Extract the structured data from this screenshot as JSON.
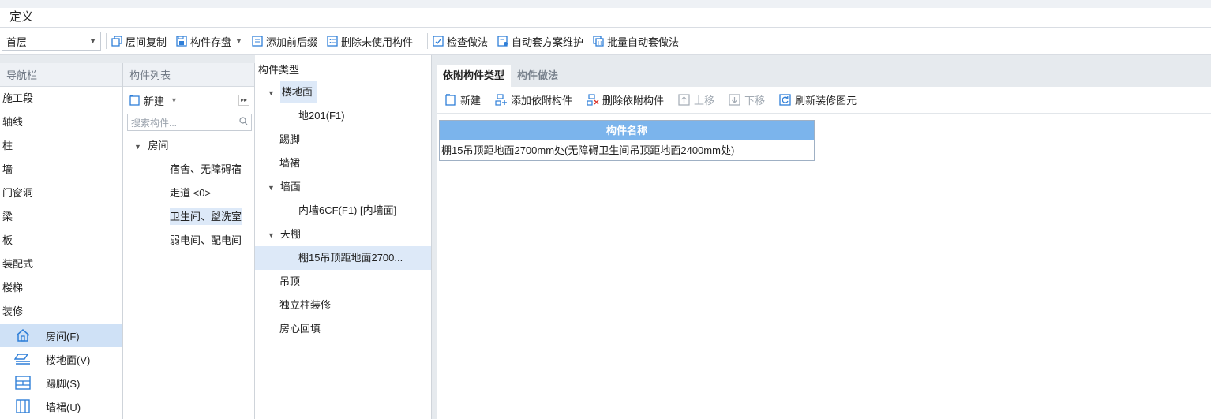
{
  "app": {
    "title": "定义"
  },
  "toolbar": {
    "floor": "首层",
    "buttons": [
      {
        "label": "层间复制",
        "icon": "copy-floors-icon",
        "dropdown": false
      },
      {
        "label": "构件存盘",
        "icon": "save-component-icon",
        "dropdown": true
      },
      {
        "label": "添加前后缀",
        "icon": "add-affix-icon",
        "dropdown": false
      },
      {
        "label": "删除未使用构件",
        "icon": "delete-unused-icon",
        "dropdown": false
      },
      {
        "label": "检查做法",
        "icon": "check-method-icon",
        "dropdown": false
      },
      {
        "label": "自动套方案维护",
        "icon": "auto-scheme-icon",
        "dropdown": false
      },
      {
        "label": "批量自动套做法",
        "icon": "batch-auto-icon",
        "dropdown": false
      }
    ]
  },
  "nav": {
    "header": "导航栏",
    "items": [
      "施工段",
      "轴线",
      "柱",
      "墙",
      "门窗洞",
      "梁",
      "板",
      "装配式",
      "楼梯",
      "装修"
    ],
    "subitems": [
      {
        "label": "房间(F)",
        "icon": "home-icon",
        "active": true
      },
      {
        "label": "楼地面(V)",
        "icon": "floor-surface-icon",
        "active": false
      },
      {
        "label": "踢脚(S)",
        "icon": "skirting-icon",
        "active": false
      },
      {
        "label": "墙裙(U)",
        "icon": "dado-icon",
        "active": false
      }
    ]
  },
  "component_list": {
    "header": "构件列表",
    "new_label": "新建",
    "search_placeholder": "搜索构件...",
    "group": "房间",
    "items": [
      "宿舍、无障碍宿",
      "走道 <0>",
      "卫生间、盥洗室",
      "弱电间、配电间"
    ],
    "selected_index": 2
  },
  "component_types": {
    "header": "构件类型",
    "rows": [
      {
        "label": "楼地面",
        "kind": "group",
        "highlight": true
      },
      {
        "label": "地201(F1)",
        "kind": "child"
      },
      {
        "label": "踢脚",
        "kind": "flat"
      },
      {
        "label": "墙裙",
        "kind": "flat"
      },
      {
        "label": "墙面",
        "kind": "group"
      },
      {
        "label": "内墙6CF(F1) [内墙面]",
        "kind": "child"
      },
      {
        "label": "天棚",
        "kind": "group"
      },
      {
        "label": "棚15吊顶距地面2700...",
        "kind": "child",
        "selected": true
      },
      {
        "label": "吊顶",
        "kind": "flat"
      },
      {
        "label": "独立柱装修",
        "kind": "flat"
      },
      {
        "label": "房心回填",
        "kind": "flat"
      }
    ]
  },
  "main": {
    "tabs": [
      {
        "label": "依附构件类型",
        "active": true
      },
      {
        "label": "构件做法",
        "active": false
      }
    ],
    "tools": [
      {
        "label": "新建",
        "icon": "new-icon",
        "disabled": false
      },
      {
        "label": "添加依附构件",
        "icon": "add-attached-icon",
        "disabled": false
      },
      {
        "label": "删除依附构件",
        "icon": "delete-attached-icon",
        "disabled": false
      },
      {
        "label": "上移",
        "icon": "move-up-icon",
        "disabled": true
      },
      {
        "label": "下移",
        "icon": "move-down-icon",
        "disabled": true
      },
      {
        "label": "刷新装修图元",
        "icon": "refresh-icon",
        "disabled": false
      }
    ],
    "grid": {
      "header": "构件名称",
      "rows": [
        "棚15吊顶距地面2700mm处(无障碍卫生间吊顶距地面2400mm处)"
      ]
    }
  },
  "colors": {
    "accent": "#1f78d1",
    "selection": "#cfe1f6",
    "grid_header": "#7bb4ec",
    "panel_header": "#eef1f5"
  }
}
